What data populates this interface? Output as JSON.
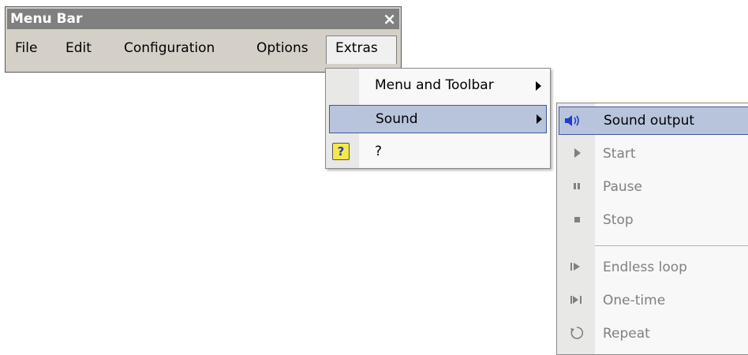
{
  "window": {
    "title": "Menu Bar",
    "close_symbol": "×"
  },
  "menubar": {
    "items": [
      {
        "label": "File"
      },
      {
        "label": "Edit"
      },
      {
        "label": "Configuration"
      },
      {
        "label": "Options"
      },
      {
        "label": "Extras"
      }
    ]
  },
  "extras_menu": {
    "items": [
      {
        "label": "Menu and Toolbar",
        "has_submenu": true
      },
      {
        "label": "Sound",
        "has_submenu": true,
        "highlighted": true
      },
      {
        "label": "?",
        "icon": "help-icon"
      }
    ]
  },
  "sound_menu": {
    "items": [
      {
        "label": "Sound output",
        "icon": "speaker-icon",
        "highlighted": true,
        "enabled": true
      },
      {
        "label": "Start",
        "icon": "play-icon",
        "enabled": false
      },
      {
        "label": "Pause",
        "icon": "pause-icon",
        "enabled": false
      },
      {
        "label": "Stop",
        "icon": "stop-icon",
        "enabled": false
      },
      {
        "label": "Endless loop",
        "icon": "loop-icon",
        "enabled": false
      },
      {
        "label": "One-time",
        "icon": "one-time-icon",
        "enabled": false
      },
      {
        "label": "Repeat",
        "icon": "repeat-icon",
        "enabled": false
      }
    ]
  },
  "colors": {
    "highlight_fill": "#b8c4dc",
    "highlight_border": "#3d5a99",
    "disabled_text": "#808080",
    "speaker_blue": "#1f3ccf"
  }
}
